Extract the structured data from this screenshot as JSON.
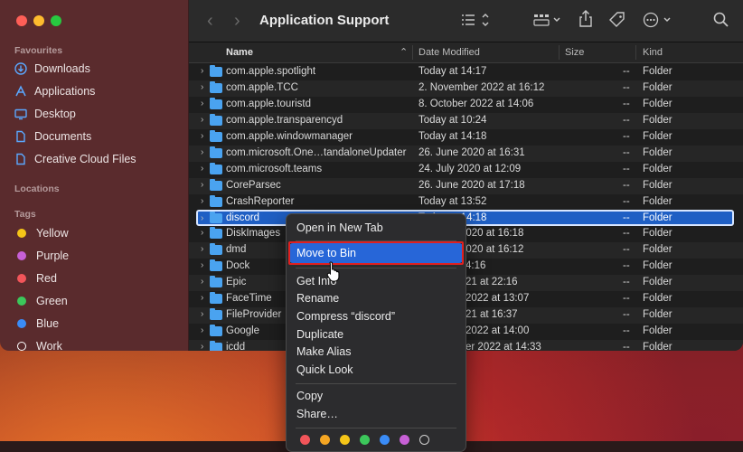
{
  "window": {
    "title": "Application Support"
  },
  "sidebar": {
    "favourites_header": "Favourites",
    "favourites": [
      {
        "label": "Downloads",
        "icon": "download-icon"
      },
      {
        "label": "Applications",
        "icon": "applications-icon"
      },
      {
        "label": "Desktop",
        "icon": "desktop-icon"
      },
      {
        "label": "Documents",
        "icon": "document-icon"
      },
      {
        "label": "Creative Cloud Files",
        "icon": "document-icon"
      }
    ],
    "locations_header": "Locations",
    "tags_header": "Tags",
    "tags": [
      {
        "label": "Yellow",
        "color": "#f5c518"
      },
      {
        "label": "Purple",
        "color": "#c760d6"
      },
      {
        "label": "Red",
        "color": "#f2555a"
      },
      {
        "label": "Green",
        "color": "#3cc75b"
      },
      {
        "label": "Blue",
        "color": "#3a8cf7"
      },
      {
        "label": "Work",
        "color": "#ffffff"
      }
    ]
  },
  "columns": {
    "name": "Name",
    "date": "Date Modified",
    "size": "Size",
    "kind": "Kind"
  },
  "rows": [
    {
      "name": "com.apple.spotlight",
      "date": "Today at 14:17",
      "size": "--",
      "kind": "Folder"
    },
    {
      "name": "com.apple.TCC",
      "date": "2. November 2022 at 16:12",
      "size": "--",
      "kind": "Folder"
    },
    {
      "name": "com.apple.touristd",
      "date": "8. October 2022 at 14:06",
      "size": "--",
      "kind": "Folder"
    },
    {
      "name": "com.apple.transparencyd",
      "date": "Today at 10:24",
      "size": "--",
      "kind": "Folder"
    },
    {
      "name": "com.apple.windowmanager",
      "date": "Today at 14:18",
      "size": "--",
      "kind": "Folder"
    },
    {
      "name": "com.microsoft.One…tandaloneUpdater",
      "date": "26. June 2020 at 16:31",
      "size": "--",
      "kind": "Folder"
    },
    {
      "name": "com.microsoft.teams",
      "date": "24. July 2020 at 12:09",
      "size": "--",
      "kind": "Folder"
    },
    {
      "name": "CoreParsec",
      "date": "26. June 2020 at 17:18",
      "size": "--",
      "kind": "Folder"
    },
    {
      "name": "CrashReporter",
      "date": "Today at 13:52",
      "size": "--",
      "kind": "Folder"
    },
    {
      "name": "discord",
      "date": "Today at 14:18",
      "size": "--",
      "kind": "Folder"
    },
    {
      "name": "DiskImages",
      "date": "2020 at 16:18",
      "size": "--",
      "kind": "Folder"
    },
    {
      "name": "dmd",
      "date": "2020 at 16:12",
      "size": "--",
      "kind": "Folder"
    },
    {
      "name": "Dock",
      "date": "4:16",
      "size": "--",
      "kind": "Folder"
    },
    {
      "name": "Epic",
      "date": "21 at 22:16",
      "size": "--",
      "kind": "Folder"
    },
    {
      "name": "FaceTime",
      "date": "2022 at 13:07",
      "size": "--",
      "kind": "Folder"
    },
    {
      "name": "FileProvider",
      "date": "21 at 16:37",
      "size": "--",
      "kind": "Folder"
    },
    {
      "name": "Google",
      "date": "2022 at 14:00",
      "size": "--",
      "kind": "Folder"
    },
    {
      "name": "icdd",
      "date": "er 2022 at 14:33",
      "size": "--",
      "kind": "Folder"
    }
  ],
  "context_menu": {
    "items": [
      "Open in New Tab",
      "Move to Bin",
      "Get Info",
      "Rename",
      "Compress “discord”",
      "Duplicate",
      "Make Alias",
      "Quick Look",
      "Copy",
      "Share…"
    ],
    "tag_colors": [
      "#f2555a",
      "#f5a623",
      "#f5c518",
      "#3cc75b",
      "#3a8cf7",
      "#c760d6",
      "#8e8e93"
    ]
  }
}
